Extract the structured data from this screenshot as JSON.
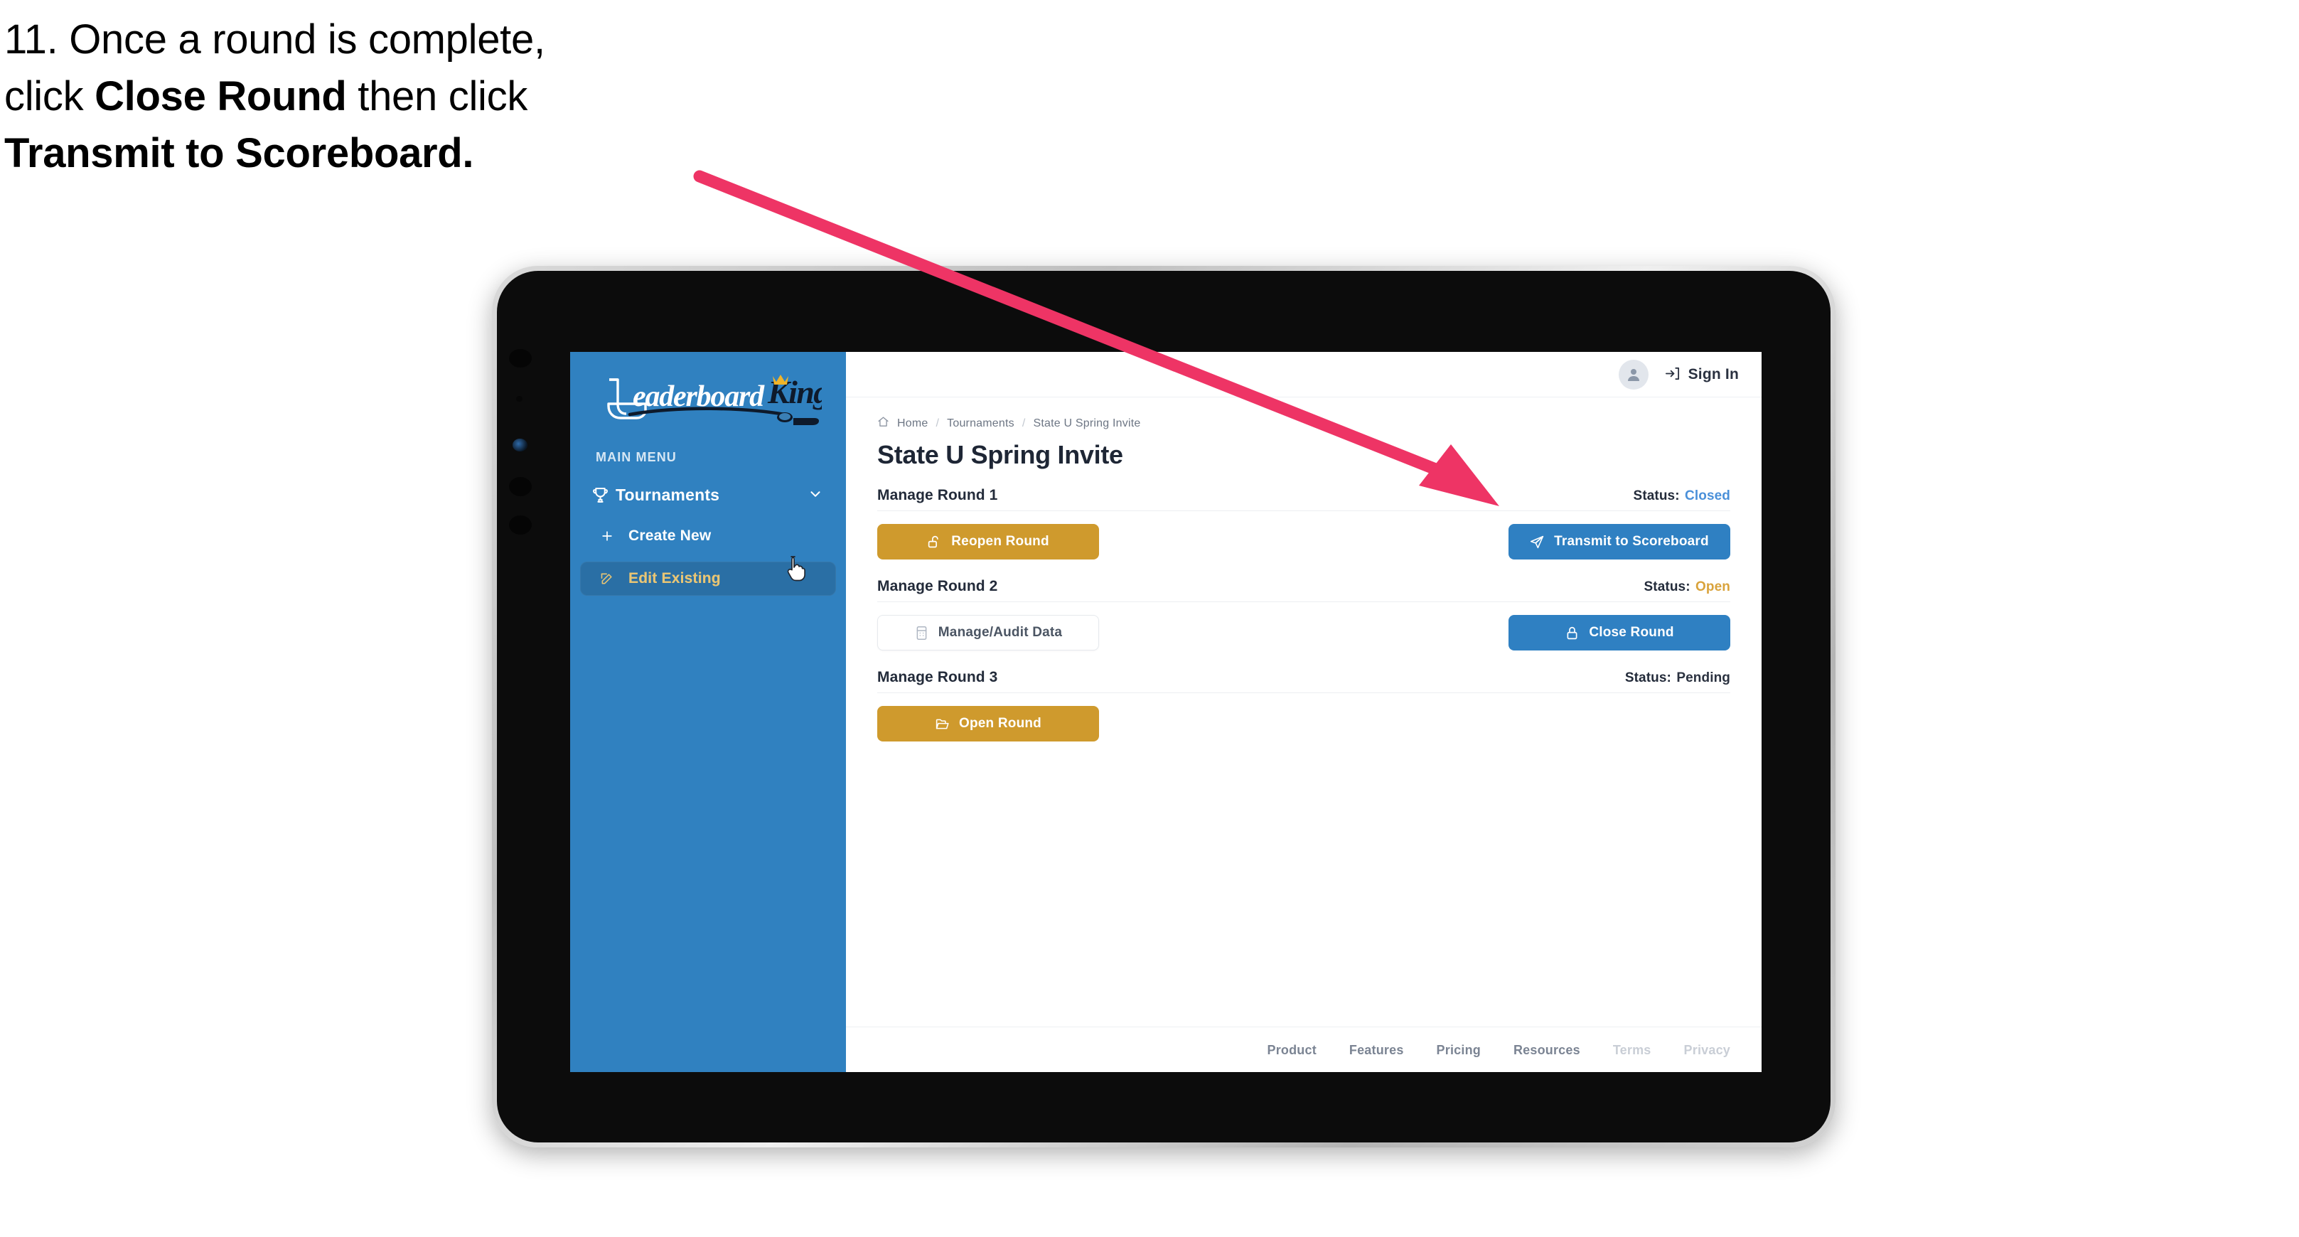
{
  "instruction": {
    "number": "11.",
    "line1_pre": "11. Once a round is complete,",
    "line2_pre": "click ",
    "line2_bold": "Close Round",
    "line2_post": " then click",
    "line3_bold": "Transmit to Scoreboard."
  },
  "annotation": {
    "arrow_color": "#ee3465",
    "points_to": "Transmit to Scoreboard"
  },
  "brand": {
    "logo_text_1": "Leaderboard",
    "logo_text_2": "King",
    "sidebar_color": "#3081c0",
    "gold_color": "#cf9a2d",
    "blue_color": "#2f80c2"
  },
  "sidebar": {
    "section_label": "MAIN MENU",
    "group": {
      "label": "Tournaments",
      "icon": "trophy-icon",
      "chevron": "chevron-down-icon",
      "expanded": true
    },
    "items": [
      {
        "label": "Create New",
        "icon": "plus-icon",
        "active": false
      },
      {
        "label": "Edit Existing",
        "icon": "pencil-square-icon",
        "active": true
      }
    ]
  },
  "topbar": {
    "avatar_icon": "user-avatar-icon",
    "signin_label": "Sign In",
    "signin_icon": "sign-in-arrow-icon"
  },
  "breadcrumb": {
    "home_icon": "home-icon",
    "items": [
      "Home",
      "Tournaments",
      "State U Spring Invite"
    ],
    "separator": "/"
  },
  "page": {
    "title": "State U Spring Invite"
  },
  "rounds": [
    {
      "title": "Manage Round 1",
      "status_label": "Status:",
      "status_value": "Closed",
      "status_state": "closed",
      "status_color": "#4a90d9",
      "left_button": {
        "label": "Reopen Round",
        "icon": "unlock-icon",
        "style": "gold"
      },
      "right_button": {
        "label": "Transmit to Scoreboard",
        "icon": "paper-plane-icon",
        "style": "blue"
      }
    },
    {
      "title": "Manage Round 2",
      "status_label": "Status:",
      "status_value": "Open",
      "status_state": "open",
      "status_color": "#d9a33c",
      "left_button": {
        "label": "Manage/Audit Data",
        "icon": "calculator-icon",
        "style": "ghost"
      },
      "right_button": {
        "label": "Close Round",
        "icon": "lock-icon",
        "style": "blue"
      }
    },
    {
      "title": "Manage Round 3",
      "status_label": "Status:",
      "status_value": "Pending",
      "status_state": "pending",
      "status_color": "#2b3240",
      "left_button": {
        "label": "Open Round",
        "icon": "open-folder-icon",
        "style": "gold"
      },
      "right_button": null
    }
  ],
  "footer": {
    "links": [
      {
        "label": "Product",
        "dim": false
      },
      {
        "label": "Features",
        "dim": false
      },
      {
        "label": "Pricing",
        "dim": false
      },
      {
        "label": "Resources",
        "dim": false
      },
      {
        "label": "Terms",
        "dim": true
      },
      {
        "label": "Privacy",
        "dim": true
      }
    ]
  },
  "cursor": {
    "type": "pointer-hand-cursor"
  }
}
